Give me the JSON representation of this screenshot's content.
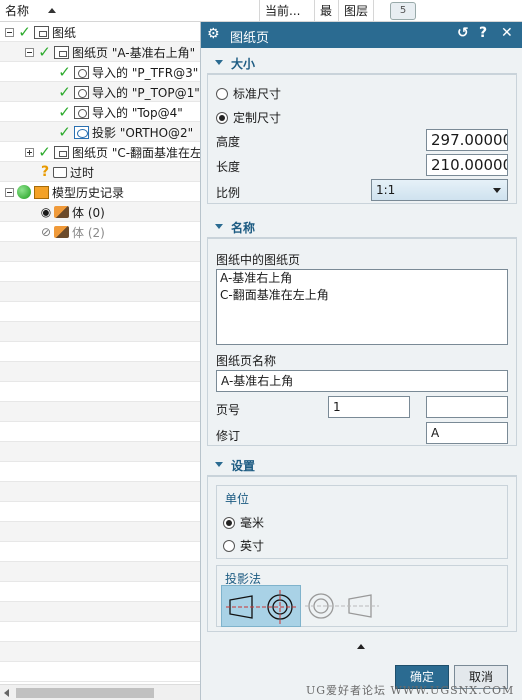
{
  "navigator": {
    "columns": {
      "name": "名称",
      "current": "当前...",
      "latest": "最",
      "layer": "图层"
    },
    "tree": [
      {
        "label": "图纸",
        "icon": "drawing-sheet-icon"
      },
      {
        "label": "图纸页 \"A-基准右上角\"",
        "icon": "sheet-icon"
      },
      {
        "label": "导入的 \"P_TFR@3\"",
        "icon": "imported-view-icon"
      },
      {
        "label": "导入的 \"P_TOP@1\"",
        "icon": "imported-view-icon"
      },
      {
        "label": "导入的 \"Top@4\"",
        "icon": "imported-view-icon"
      },
      {
        "label": "投影 \"ORTHO@2\"",
        "icon": "projected-view-icon"
      },
      {
        "label": "图纸页 \"C-翻面基准在左",
        "icon": "sheet-icon"
      },
      {
        "label": "过时",
        "icon": "folder-icon"
      },
      {
        "label": "模型历史记录",
        "icon": "history-icon"
      },
      {
        "label": "体 (0)",
        "icon": "body-icon"
      },
      {
        "label": "体 (2)",
        "icon": "body-icon"
      }
    ]
  },
  "dialog": {
    "title": "图纸页",
    "size_section": {
      "header": "大小",
      "standard_label": "标准尺寸",
      "custom_label": "定制尺寸",
      "height_label": "高度",
      "height_value": "297.00000",
      "length_label": "长度",
      "length_value": "210.00000",
      "scale_label": "比例",
      "scale_value": "1:1"
    },
    "name_section": {
      "header": "名称",
      "sheets_label": "图纸中的图纸页",
      "sheets": [
        "A-基准右上角",
        "C-翻面基准在左上角"
      ],
      "sheet_name_label": "图纸页名称",
      "sheet_name_value": "A-基准右上角",
      "page_label": "页号",
      "page_value": "1",
      "page_value2": "",
      "revision_label": "修订",
      "revision_value": "A"
    },
    "settings_section": {
      "header": "设置",
      "units_label": "单位",
      "mm_label": "毫米",
      "inch_label": "英寸",
      "projection_label": "投影法"
    },
    "ok_label": "确定",
    "cancel_label": "取消"
  },
  "watermark": "UG爱好者论坛 WWW.UGSNX.COM",
  "colors": {
    "title_bar": "#2b6b91",
    "section_text": "#1c5b82",
    "check": "#2eaa2e",
    "projection_selected": "#a9d2e6"
  }
}
